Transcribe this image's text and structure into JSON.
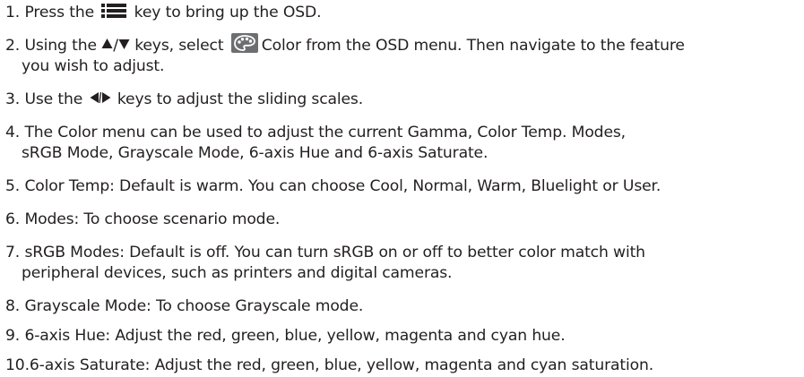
{
  "steps": [
    {
      "num": "1.",
      "before": "Press the",
      "after": "key to bring up the OSD.",
      "icons": [
        "list-menu-icon"
      ]
    },
    {
      "num": "2.",
      "before": "Using the",
      "mid": "keys, select",
      "after": "Color from the OSD menu. Then navigate to the feature",
      "cont": "you wish to adjust.",
      "icons": [
        "up-arrow-icon",
        "down-arrow-icon",
        "color-palette-icon"
      ]
    },
    {
      "num": "3.",
      "before": "Use the",
      "after": "keys to adjust the sliding scales.",
      "icons": [
        "left-arrow-icon",
        "right-arrow-icon"
      ]
    },
    {
      "num": "4.",
      "text": "The Color menu can be used to adjust the current Gamma, Color Temp. Modes,",
      "cont": "sRGB Mode, Grayscale Mode, 6-axis Hue and 6-axis Saturate."
    },
    {
      "num": "5.",
      "text": "Color Temp: Default is warm. You can choose Cool, Normal, Warm, Bluelight or User."
    },
    {
      "num": "6.",
      "text": "Modes: To choose scenario mode."
    },
    {
      "num": "7.",
      "text": "sRGB Modes: Default is off. You can turn sRGB on or off to better color match with",
      "cont": "peripheral devices, such as printers and digital cameras."
    },
    {
      "num": "8.",
      "text": "Grayscale Mode: To choose Grayscale mode."
    },
    {
      "num": "9.",
      "text": "6-axis Hue: Adjust the red, green, blue, yellow, magenta and cyan hue."
    },
    {
      "num": "10.",
      "text": "6-axis Saturate: Adjust the red, green, blue, yellow, magenta and cyan saturation."
    }
  ],
  "colors": {
    "text": "#231f20",
    "palette_bg": "#6d6e70"
  }
}
